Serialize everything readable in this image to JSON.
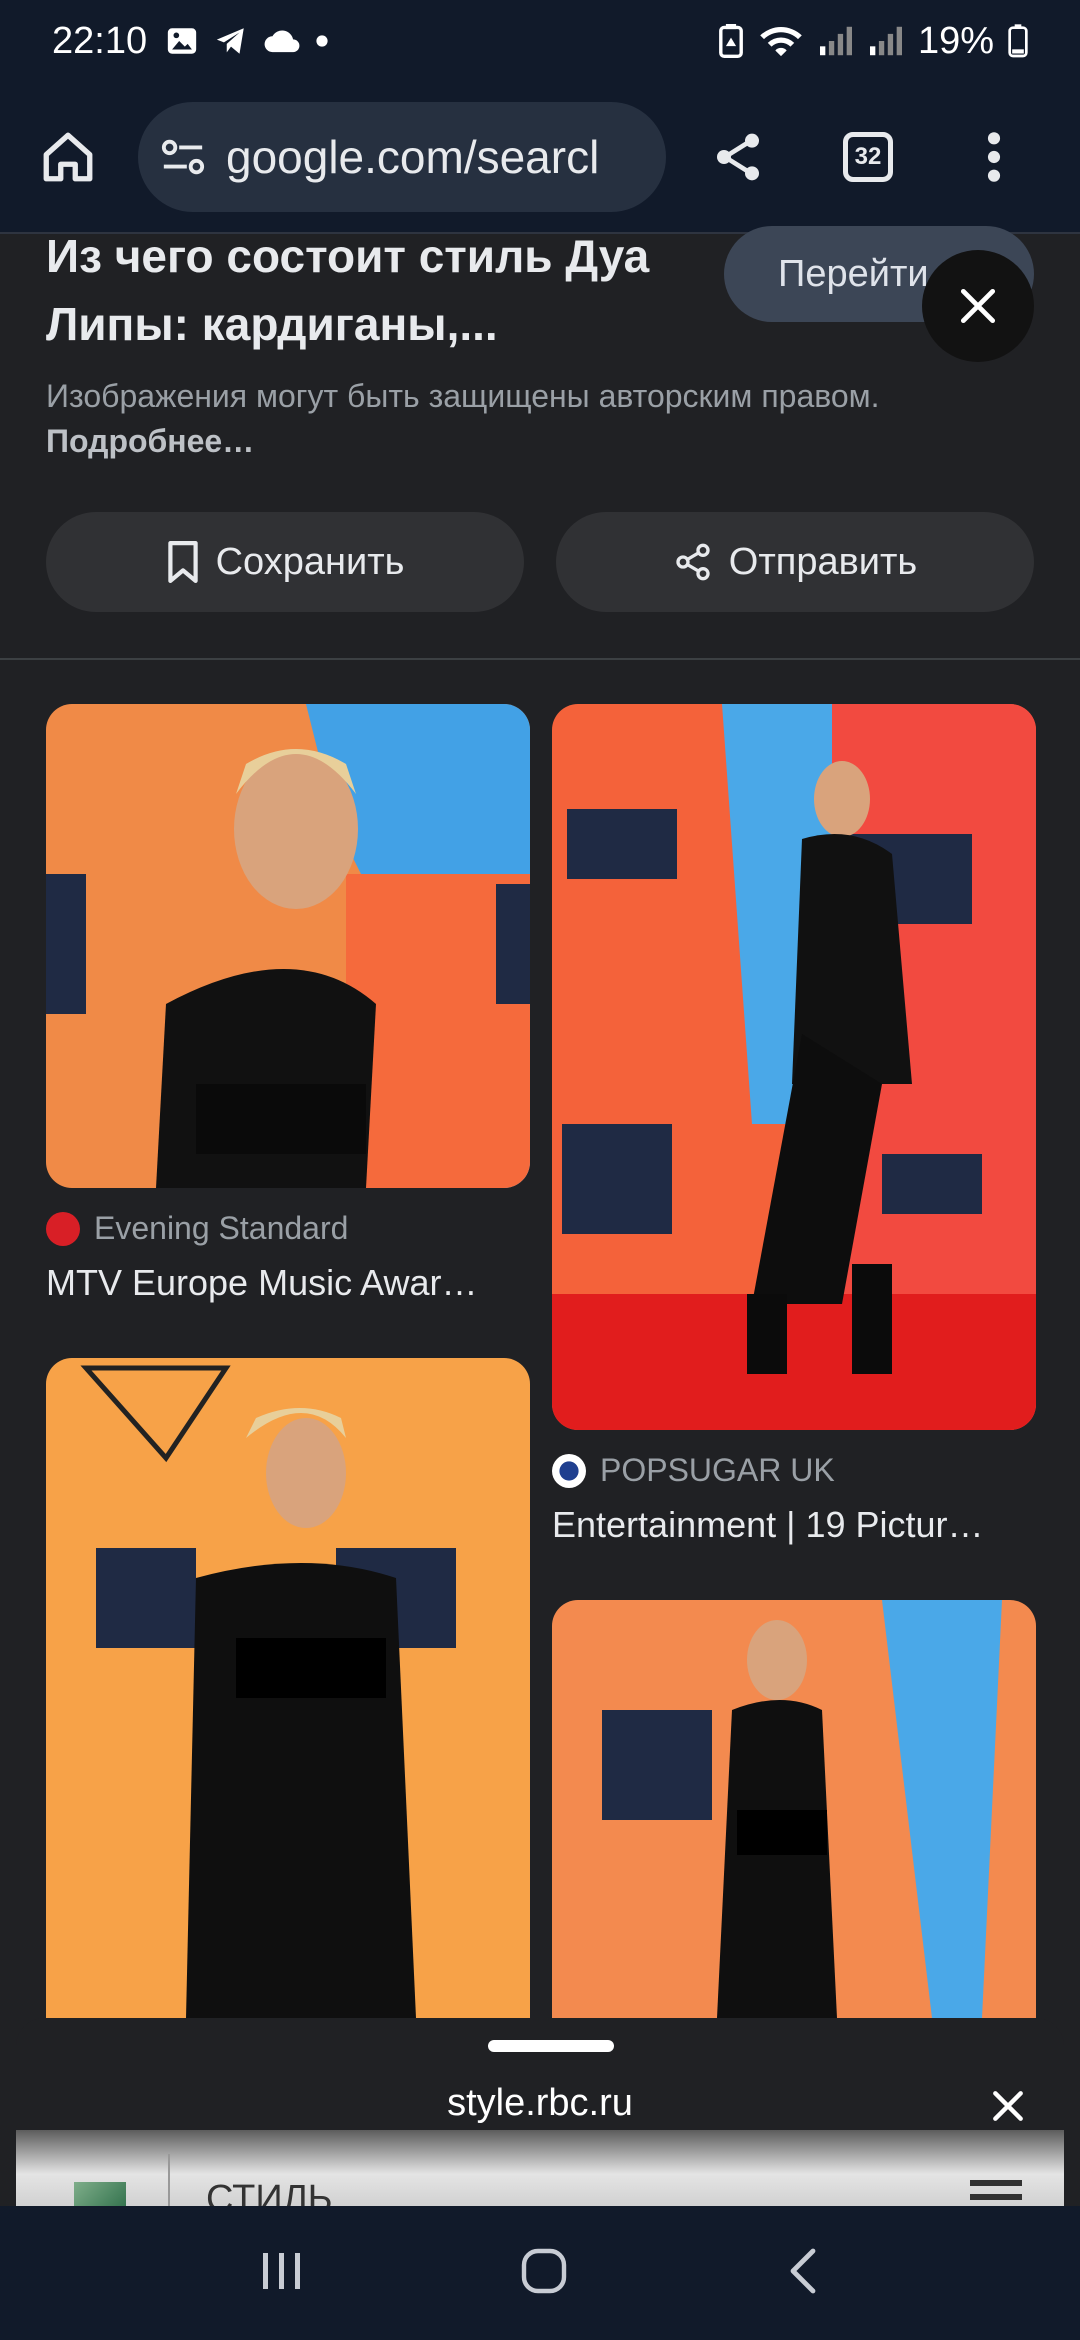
{
  "status_bar": {
    "time": "22:10",
    "battery": "19%"
  },
  "browser": {
    "url": "google.com/searcl",
    "tab_count": "32"
  },
  "panel": {
    "title": "Из чего состоит стиль Дуа Липы: кардиганы,...",
    "goto_label": "Перейти",
    "copyright_text": "Изображения могут быть защищены авторским правом.",
    "copyright_more": "Подробнее…",
    "save_label": "Сохранить",
    "share_label": "Отправить"
  },
  "results": [
    {
      "source": "Evening Standard",
      "caption": "MTV Europe Music Awar…"
    },
    {
      "source": "POPSUGAR UK",
      "caption": "Entertainment | 19 Pictur…"
    }
  ],
  "bottom_sheet": {
    "domain": "style.rbc.ru",
    "preview_text": "СТИЛЬ"
  },
  "colors": {
    "background": "#202124",
    "toolbar": "#111a2a",
    "button": "#303134",
    "goto_button": "#3c4656"
  }
}
